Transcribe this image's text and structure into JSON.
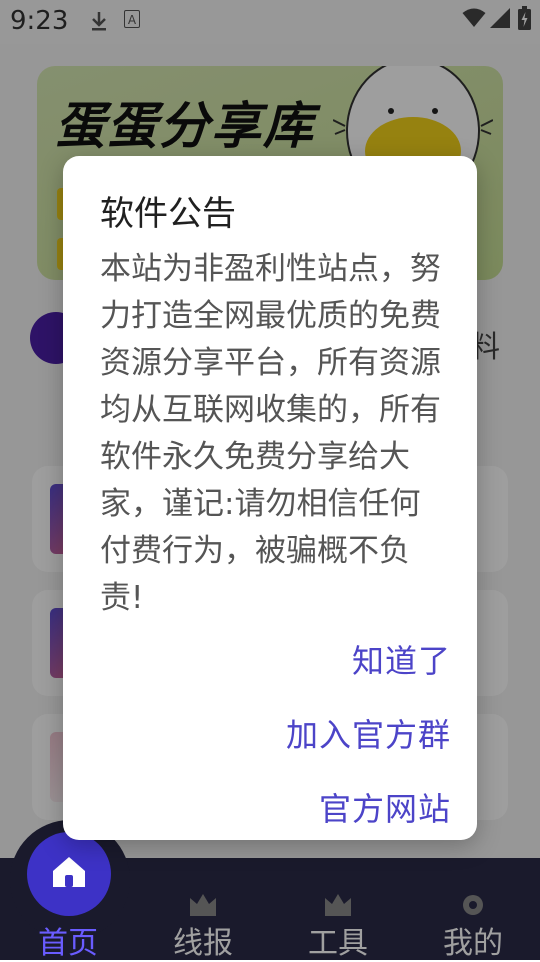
{
  "status_bar": {
    "time": "9:23",
    "icons": [
      "download-icon",
      "a-badge-icon",
      "wifi-icon",
      "signal-icon",
      "battery-icon"
    ]
  },
  "banner": {
    "title": "蛋蛋分享库"
  },
  "categories": {
    "visible_fragment": "料"
  },
  "dialog": {
    "title": "软件公告",
    "body": "本站为非盈利性站点，努力打造全网最优质的免费资源分享平台，所有资源均从互联网收集的，所有软件永久免费分享给大家，谨记:请勿相信任何付费行为，被骗概不负责!",
    "buttons": {
      "ok": "知道了",
      "join_group": "加入官方群",
      "website": "官方网站"
    }
  },
  "bottom_nav": {
    "items": [
      {
        "label": "首页",
        "icon": "home-icon",
        "active": true
      },
      {
        "label": "线报",
        "icon": "crown-icon",
        "active": false
      },
      {
        "label": "工具",
        "icon": "crown-icon",
        "active": false
      },
      {
        "label": "我的",
        "icon": "flower-icon",
        "active": false
      }
    ]
  },
  "colors": {
    "accent": "#4c44c8",
    "nav_background": "#1a1a2c",
    "active_nav": "#6a5cff",
    "home_button": "#3d32c6"
  }
}
